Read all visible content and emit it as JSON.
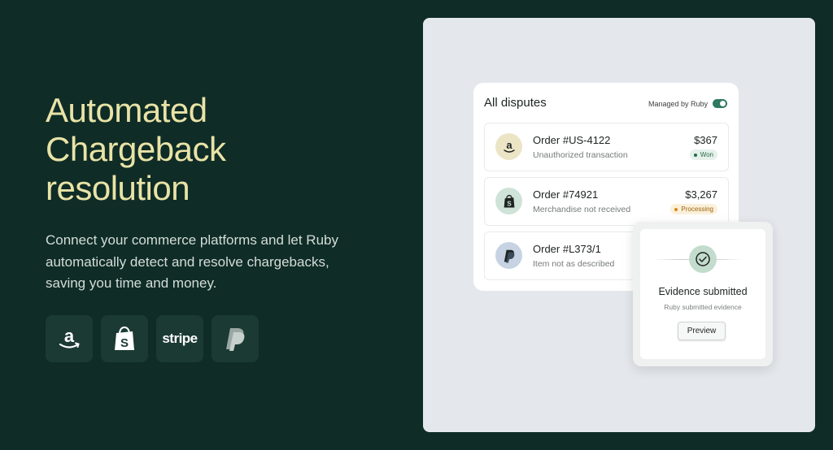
{
  "hero": {
    "title_lines": [
      "Automated",
      "Chargeback",
      "resolution"
    ],
    "subtitle": "Connect your commerce platforms and let Ruby automatically detect and resolve chargebacks, saving you time and money."
  },
  "platforms": [
    {
      "name": "amazon",
      "icon": "amazon-icon"
    },
    {
      "name": "shopify",
      "icon": "shopify-icon"
    },
    {
      "name": "stripe",
      "label": "stripe"
    },
    {
      "name": "paypal",
      "icon": "paypal-icon"
    }
  ],
  "disputes": {
    "title": "All disputes",
    "managed_label": "Managed by Ruby",
    "managed_toggle_on": true,
    "items": [
      {
        "order": "Order #US-4122",
        "reason": "Unauthorized transaction",
        "amount": "$367",
        "status": "Won",
        "platform_icon": "amazon-icon"
      },
      {
        "order": "Order #74921",
        "reason": "Merchandise not received",
        "amount": "$3,267",
        "status": "Processing",
        "platform_icon": "shopify-icon"
      },
      {
        "order": "Order #L373/1",
        "reason": "Item not as described",
        "platform_icon": "paypal-icon"
      }
    ]
  },
  "evidence": {
    "title": "Evidence submitted",
    "subtitle": "Ruby submitted evidence",
    "button_label": "Preview",
    "icon": "check-circle-icon"
  },
  "colors": {
    "background": "#0f2c27",
    "title": "#e9e3a6",
    "panel": "#e4e8ec",
    "accent": "#2e7a5e"
  }
}
